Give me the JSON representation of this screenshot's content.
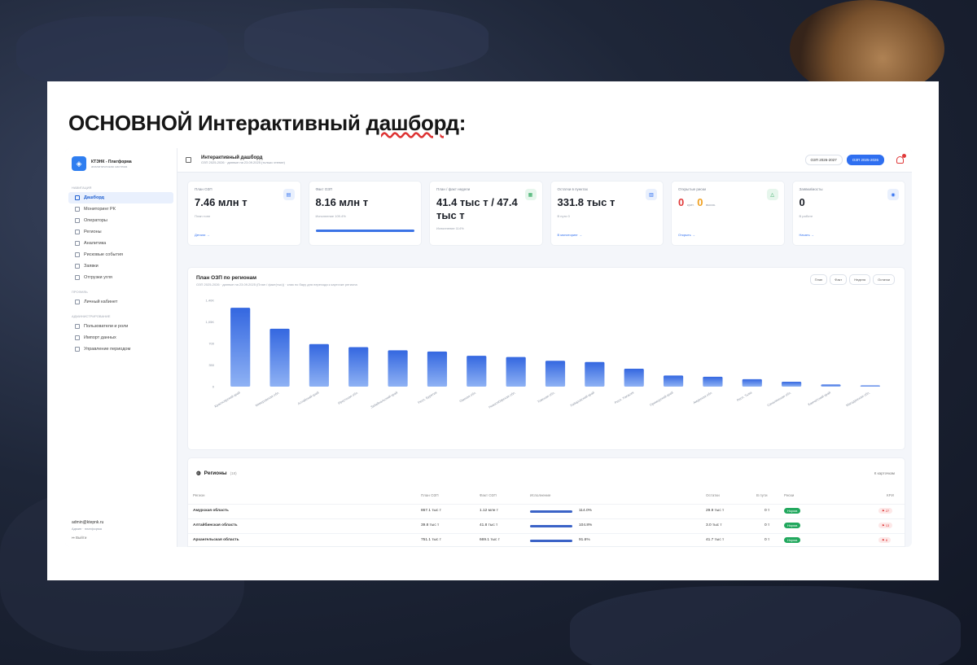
{
  "slide": {
    "title_part1": "ОСНОВНОЙ Интерактивный ",
    "title_part2": "дашборд",
    "title_colon": ":"
  },
  "sidebar": {
    "brand_name": "КТЭНК - Платформа",
    "brand_sub": "аналитическая система",
    "groups": [
      {
        "label": "Навигация",
        "items": [
          {
            "label": "Дашборд",
            "active": true
          },
          {
            "label": "Мониторинг РК"
          },
          {
            "label": "Операторы"
          },
          {
            "label": "Регионы"
          },
          {
            "label": "Аналитика"
          },
          {
            "label": "Рисковые события"
          },
          {
            "label": "Заявки"
          },
          {
            "label": "Отгрузки угля"
          }
        ]
      },
      {
        "label": "Профиль",
        "items": [
          {
            "label": "Личный кабинет"
          }
        ]
      },
      {
        "label": "Администрирование",
        "items": [
          {
            "label": "Пользователи и роли"
          },
          {
            "label": "Импорт данных"
          },
          {
            "label": "Управление периодом"
          }
        ]
      }
    ],
    "user_email": "admin@ktepnk.ru",
    "user_role": "Админ · платформа",
    "logout": "Выйти"
  },
  "topbar": {
    "title": "Интерактивный дашборд",
    "subtitle": "ОЗП 2025-2026 · данные на 23.09.2025 (только чтение)",
    "period_prev": "ОЗП 2026-2027",
    "period_current": "ОЗП 2025-2026"
  },
  "kpis": [
    {
      "label": "План ОЗП",
      "value": "7.46 млн т",
      "sub": "План тонн",
      "link": "Детали →"
    },
    {
      "label": "Факт ОЗП",
      "value": "8.16 млн т",
      "sub": "Исполнение 109.4%",
      "progress": 1.0
    },
    {
      "label": "План / факт недели",
      "value": "41.4 тыс т / 47.4 тыс т",
      "sub": "Исполнение 114%"
    },
    {
      "label": "Остатки в пунктах",
      "value": "331.8 тыс т",
      "sub": "В пути 0",
      "link": "В мониторинг →"
    },
    {
      "label": "Открытые риски",
      "value_red": "0",
      "unit_red": "крит.",
      "value_orange": "0",
      "unit_orange": "высок.",
      "link": "Открыть →"
    },
    {
      "label": "Заявки/мосты",
      "value": "0",
      "sub": "В работе",
      "link": "Начать →"
    }
  ],
  "chart_card": {
    "title": "План ОЗП по регионам",
    "subtitle": "ОЗП 2025-2026 · данные на 23.09.2025 (План / факт(тыс)) · клик по бару для перехода к карточке региона",
    "filters": [
      "План",
      "Факт",
      "Неделя",
      "Остатки"
    ]
  },
  "chart_data": {
    "type": "bar",
    "categories": [
      "Красноярский край",
      "Кемеровская обл.",
      "Алтайский край",
      "Иркутская обл.",
      "Забайкальский край",
      "Респ. Бурятия",
      "Омская обл.",
      "Новосибирская обл.",
      "Томская обл.",
      "Хабаровский край",
      "Респ. Хакасия",
      "Приморский край",
      "Амурская обл.",
      "Респ. Тыва",
      "Сахалинская обл.",
      "Камчатский край",
      "Магаданская обл."
    ],
    "values": [
      1280,
      940,
      690,
      640,
      590,
      570,
      500,
      480,
      420,
      400,
      290,
      180,
      160,
      120,
      80,
      35,
      20
    ],
    "ylim": [
      0,
      1400
    ],
    "yticks": [
      "0",
      "350",
      "700",
      "1,05K",
      "1,40K"
    ],
    "grid": false
  },
  "regions_table": {
    "title": "Регионы",
    "count": "(18)",
    "link": "К карточкам",
    "headers": [
      "Регион",
      "План ОЗП",
      "Факт ОЗП",
      "Исполнение",
      "Остатки",
      "В пути",
      "Риски",
      "КРИ"
    ],
    "rows": [
      {
        "name": "Амурская область",
        "plan": "867.1 тыс т",
        "fact": "1.12 млн т",
        "exec": "114.0%",
        "stock": "29.9 тыс т",
        "transit": "0 т",
        "risk": "Норма",
        "kri": "⚑ 27"
      },
      {
        "name": "Алтайбинская область",
        "plan": "39.8 тыс т",
        "fact": "41.8 тыс т",
        "exec": "104.8%",
        "stock": "3.0 тыс т",
        "transit": "0 т",
        "risk": "Норма",
        "kri": "⚑ 13"
      },
      {
        "name": "Архангельская область",
        "plan": "751.1 тыс т",
        "fact": "669.1 тыс т",
        "exec": "91.6%",
        "stock": "41.7 тыс т",
        "transit": "0 т",
        "risk": "Норма",
        "kri": "⚑ 8"
      }
    ]
  },
  "colors": {
    "accent": "#2f6ff0",
    "bar": "#3b73e6",
    "ok": "#22a85e",
    "danger": "#e03a3a"
  }
}
